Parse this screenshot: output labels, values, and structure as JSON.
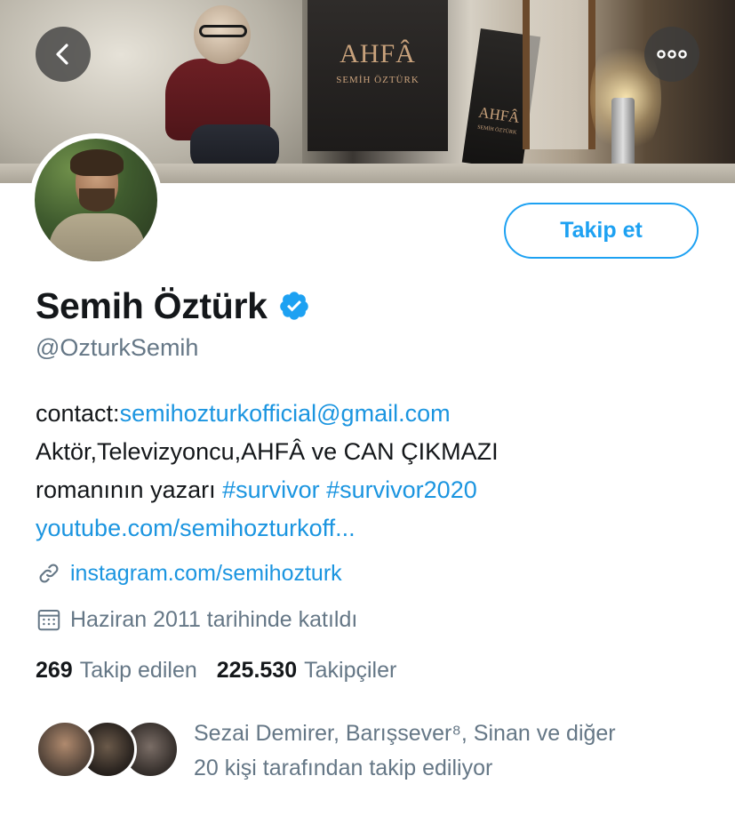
{
  "header": {
    "banner_book_title": "AHFÂ",
    "banner_book_author": "SEMİH ÖZTÜRK",
    "back_icon": "chevron-left-icon",
    "more_icon": "ellipsis-icon"
  },
  "profile": {
    "follow_button_label": "Takip et",
    "name": "Semih Öztürk",
    "verified_icon": "verified-badge-icon",
    "handle": "@OzturkSemih"
  },
  "bio": {
    "contact_prefix": "contact:",
    "contact_email": "semihozturkofficial@gmail.com",
    "line2": "Aktör,Televizyoncu,AHFÂ ve CAN ÇIKMAZI",
    "line3_text": "romanının yazarı ",
    "hashtag1": "#survivor",
    "hashtag2": "#survivor2020",
    "youtube_link": "youtube.com/semihozturkoff..."
  },
  "meta": {
    "website": "instagram.com/semihozturk",
    "joined": "Haziran 2011 tarihinde katıldı"
  },
  "stats": {
    "following_count": "269",
    "following_label": "Takip edilen",
    "followers_count": "225.530",
    "followers_label": "Takipçiler"
  },
  "followed_by": {
    "line1": "Sezai Demirer, Barışsever⁸, Sinan ve diğer",
    "line2": "20 kişi tarafından takip ediliyor"
  },
  "colors": {
    "accent": "#1da1f2",
    "link": "#1b95e0",
    "secondary_text": "#657786",
    "primary_text": "#14171a"
  }
}
